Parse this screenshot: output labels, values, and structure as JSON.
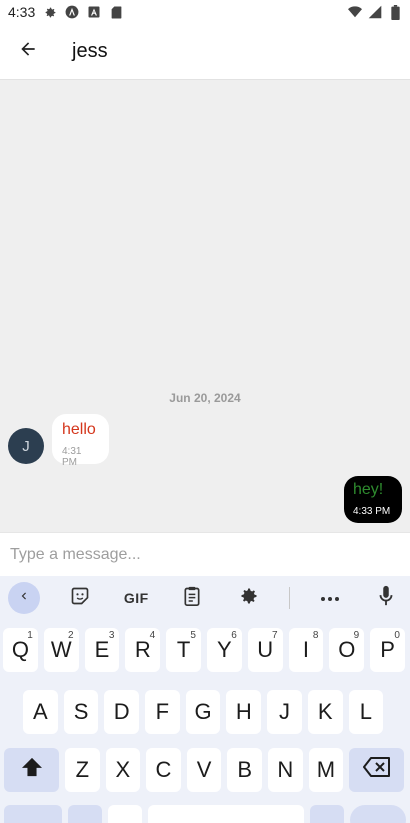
{
  "status": {
    "time": "4:33"
  },
  "header": {
    "title": "jess"
  },
  "conversation": {
    "date_separator": "Jun 20, 2024",
    "contact_initial": "J",
    "messages": [
      {
        "direction": "incoming",
        "text": "hello",
        "time": "4:31 PM",
        "color": "#d4361c"
      },
      {
        "direction": "outgoing",
        "text": "hey!",
        "time": "4:33 PM",
        "color": "#2e8b2e"
      }
    ]
  },
  "composer": {
    "placeholder": "Type a message..."
  },
  "keyboard": {
    "toolbar": {
      "gif_label": "GIF"
    },
    "row1": [
      {
        "key": "Q",
        "hint": "1"
      },
      {
        "key": "W",
        "hint": "2"
      },
      {
        "key": "E",
        "hint": "3"
      },
      {
        "key": "R",
        "hint": "4"
      },
      {
        "key": "T",
        "hint": "5"
      },
      {
        "key": "Y",
        "hint": "6"
      },
      {
        "key": "U",
        "hint": "7"
      },
      {
        "key": "I",
        "hint": "8"
      },
      {
        "key": "O",
        "hint": "9"
      },
      {
        "key": "P",
        "hint": "0"
      }
    ],
    "row2": [
      "A",
      "S",
      "D",
      "F",
      "G",
      "H",
      "J",
      "K",
      "L"
    ],
    "row3": [
      "Z",
      "X",
      "C",
      "V",
      "B",
      "N",
      "M"
    ]
  },
  "colors": {
    "accent_soft": "#c9d3f2",
    "avatar_bg": "#2c3e50",
    "incoming_text": "#d4361c",
    "outgoing_text": "#2e8b2e",
    "outgoing_bubble": "#000000"
  },
  "icons": {
    "status_left": [
      "gear-icon",
      "android-studio-icon",
      "app-a-icon",
      "sd-card-icon"
    ],
    "status_right": [
      "wifi-icon",
      "signal-icon",
      "battery-icon"
    ],
    "header": "back-arrow-icon",
    "toolbar": [
      "collapse-chevron-icon",
      "sticker-icon",
      "gif-icon",
      "clipboard-icon",
      "gear-icon",
      "more-icon",
      "mic-icon"
    ],
    "keys": [
      "shift-icon",
      "backspace-icon"
    ]
  }
}
